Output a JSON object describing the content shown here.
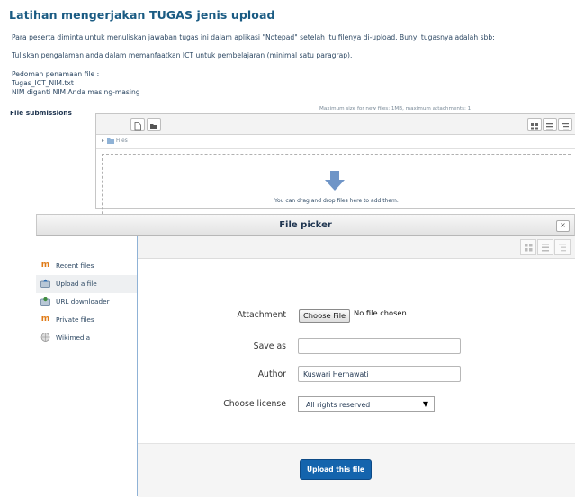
{
  "page": {
    "title": "Latihan mengerjakan TUGAS jenis upload",
    "paragraphs": [
      "Para peserta diminta untuk menuliskan jawaban tugas ini dalam aplikasi \"Notepad\" setelah itu filenya di-upload. Bunyi tugasnya adalah sbb:",
      "Tuliskan pengalaman anda dalam memanfaatkan ICT untuk pembelajaran (minimal satu paragrap).",
      "Pedoman penamaan file :",
      "Tugas_ICT_NIM.txt",
      "NIM diganti NIM Anda masing-masing"
    ],
    "file_submissions_label": "File submissions",
    "max_size_text": "Maximum size for new files: 1MB, maximum attachments: 1",
    "path_label": "Files",
    "drop_text": "You can drag and drop files here to add them."
  },
  "file_picker": {
    "title": "File picker",
    "close_label": "×",
    "sidebar": [
      {
        "label": "Recent files",
        "icon": "moodle-icon",
        "selected": false
      },
      {
        "label": "Upload a file",
        "icon": "upload-icon",
        "selected": true
      },
      {
        "label": "URL downloader",
        "icon": "url-icon",
        "selected": false
      },
      {
        "label": "Private files",
        "icon": "moodle-icon",
        "selected": false
      },
      {
        "label": "Wikimedia",
        "icon": "wikimedia-icon",
        "selected": false
      }
    ],
    "form": {
      "attachment_label": "Attachment",
      "choose_file_label": "Choose File",
      "no_file_text": "No file chosen",
      "save_as_label": "Save as",
      "save_as_value": "",
      "author_label": "Author",
      "author_value": "Kuswari Hernawati",
      "license_label": "Choose license",
      "license_value": "All rights reserved"
    },
    "upload_button_label": "Upload this file"
  },
  "colors": {
    "title": "#1a5b83",
    "accent_button": "#1464ad",
    "sidebar_border": "#8fb2d6"
  }
}
